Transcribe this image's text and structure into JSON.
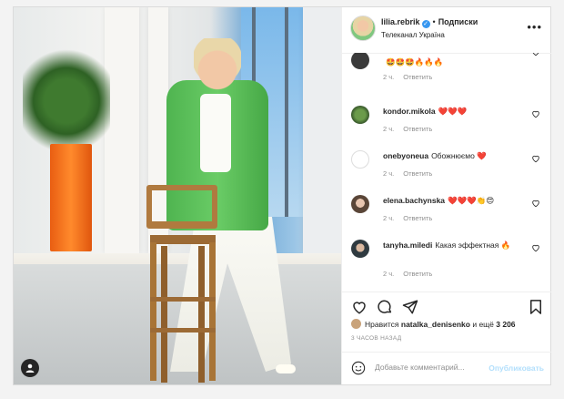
{
  "post": {
    "username": "lilia.rebrik",
    "follow_label": "Подписки",
    "location": "Телеканал Україна",
    "more_label": "•••"
  },
  "comments": [
    {
      "user": "",
      "text": "🤩🤩🤩🔥🔥🔥",
      "time": "2 ч.",
      "reply": "Ответить"
    },
    {
      "user": "kondor.mikola",
      "text": "❤️❤️❤️",
      "time": "2 ч.",
      "reply": "Ответить"
    },
    {
      "user": "onebyoneua",
      "text": "Обожнюємо ❤️",
      "time": "2 ч.",
      "reply": "Ответить"
    },
    {
      "user": "elena.bachynska",
      "text": "❤️❤️❤️👏😍",
      "time": "2 ч.",
      "reply": "Ответить"
    },
    {
      "user": "tanyha.miledi",
      "text": "Какая эффектная 🔥",
      "time": "2 ч.",
      "reply": "Ответить"
    }
  ],
  "likes": {
    "prefix": "Нравится",
    "user": "natalka_denisenko",
    "middle": "и ещё",
    "count": "3 206"
  },
  "time_ago": "3 ЧАСОВ НАЗАД",
  "add_comment": {
    "placeholder": "Добавьте комментарий...",
    "publish_label": "Опубликовать"
  },
  "colors": {
    "accent_blue": "#3897f0",
    "publish_disabled": "#b2dffc",
    "heart_red": "#ed2939",
    "jacket_green": "#5cbf5a",
    "pot_orange": "#ff7a1f"
  }
}
